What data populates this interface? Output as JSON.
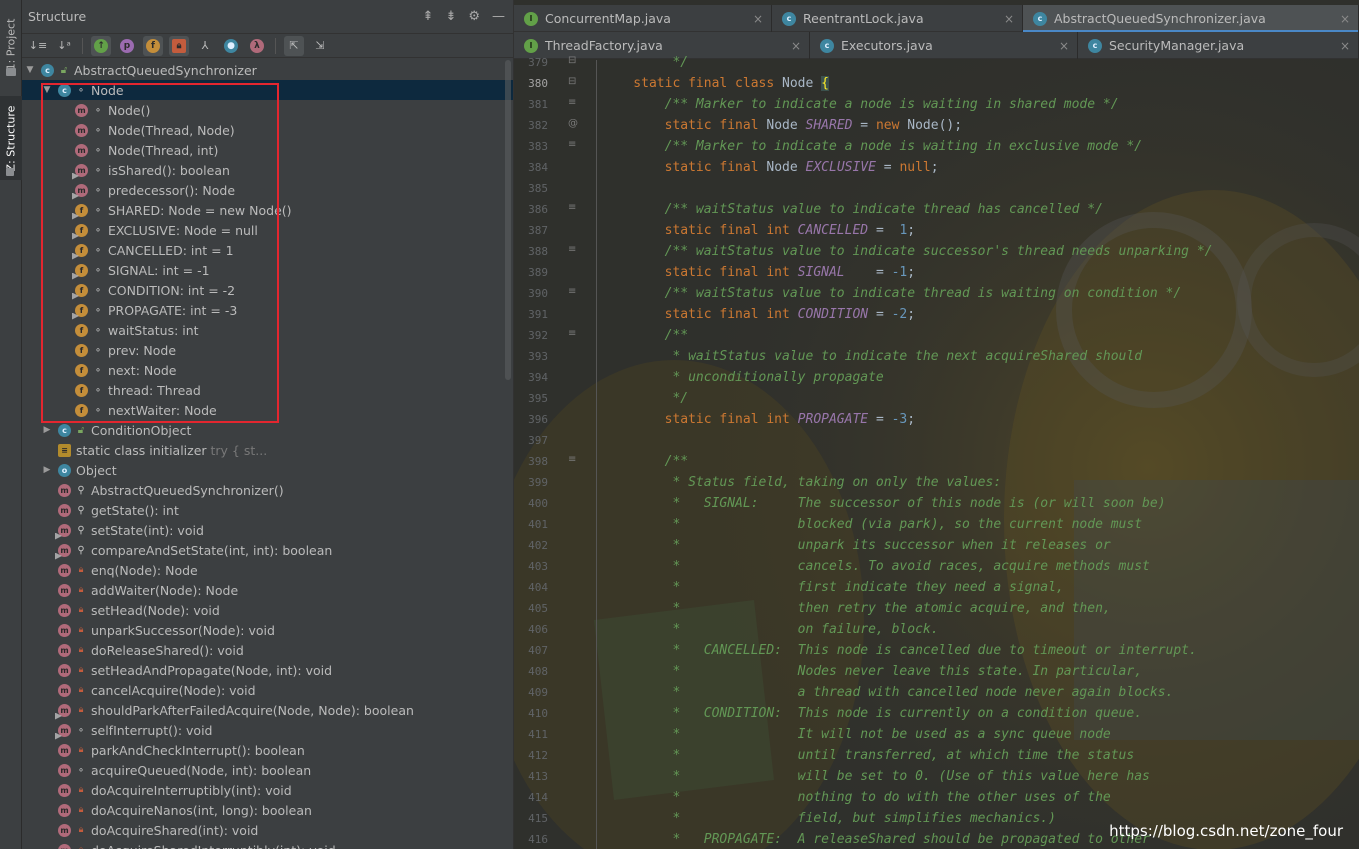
{
  "strip": {
    "project_tab": "1: Project",
    "structure_tab": "Z: Structure"
  },
  "panel": {
    "title": "Structure",
    "header_icons": [
      "expand-all-icon",
      "collapse-all-icon",
      "settings-gear-icon",
      "hide-icon"
    ],
    "toolbar_icons": [
      "sort-by-visibility-icon",
      "sort-alphabetically-icon",
      "show-inherited-icon",
      "show-properties-icon",
      "show-fields-icon",
      "show-non-public-icon",
      "show-lambdas-icon",
      "show-anonymous-icon",
      "show-lambda-icon",
      "autoscroll-to-source-icon",
      "autoscroll-from-source-icon"
    ]
  },
  "tree": [
    {
      "indent": 0,
      "arrow": "▼",
      "icon": "c",
      "vis": "pub",
      "label": "AbstractQueuedSynchronizer",
      "hint": ""
    },
    {
      "indent": 1,
      "arrow": "▼",
      "icon": "c",
      "vis": "prot",
      "label": "Node",
      "hint": "",
      "selected": true
    },
    {
      "indent": 2,
      "arrow": "",
      "icon": "m",
      "vis": "prot",
      "label": "Node()",
      "hint": ""
    },
    {
      "indent": 2,
      "arrow": "",
      "icon": "m",
      "vis": "prot",
      "label": "Node(Thread, Node)",
      "hint": ""
    },
    {
      "indent": 2,
      "arrow": "",
      "icon": "m",
      "vis": "prot",
      "label": "Node(Thread, int)",
      "hint": ""
    },
    {
      "indent": 2,
      "arrow": "",
      "icon": "m",
      "vis": "prot",
      "label": "isShared(): boolean",
      "pin": true,
      "hint": ""
    },
    {
      "indent": 2,
      "arrow": "",
      "icon": "m",
      "vis": "prot",
      "label": "predecessor(): Node",
      "pin": true,
      "hint": ""
    },
    {
      "indent": 2,
      "arrow": "",
      "icon": "f",
      "vis": "prot",
      "label": "SHARED: Node = new Node()",
      "pin": true,
      "hint": ""
    },
    {
      "indent": 2,
      "arrow": "",
      "icon": "f",
      "vis": "prot",
      "label": "EXCLUSIVE: Node = null",
      "pin": true,
      "hint": ""
    },
    {
      "indent": 2,
      "arrow": "",
      "icon": "f",
      "vis": "prot",
      "label": "CANCELLED: int = 1",
      "pin": true,
      "hint": ""
    },
    {
      "indent": 2,
      "arrow": "",
      "icon": "f",
      "vis": "prot",
      "label": "SIGNAL: int = -1",
      "pin": true,
      "hint": ""
    },
    {
      "indent": 2,
      "arrow": "",
      "icon": "f",
      "vis": "prot",
      "label": "CONDITION: int = -2",
      "pin": true,
      "hint": ""
    },
    {
      "indent": 2,
      "arrow": "",
      "icon": "f",
      "vis": "prot",
      "label": "PROPAGATE: int = -3",
      "pin": true,
      "hint": ""
    },
    {
      "indent": 2,
      "arrow": "",
      "icon": "f",
      "vis": "prot",
      "label": "waitStatus: int",
      "hint": ""
    },
    {
      "indent": 2,
      "arrow": "",
      "icon": "f",
      "vis": "prot",
      "label": "prev: Node",
      "hint": ""
    },
    {
      "indent": 2,
      "arrow": "",
      "icon": "f",
      "vis": "prot",
      "label": "next: Node",
      "hint": ""
    },
    {
      "indent": 2,
      "arrow": "",
      "icon": "f",
      "vis": "prot",
      "label": "thread: Thread",
      "hint": ""
    },
    {
      "indent": 2,
      "arrow": "",
      "icon": "f",
      "vis": "prot",
      "label": "nextWaiter: Node",
      "hint": ""
    },
    {
      "indent": 1,
      "arrow": "▶",
      "icon": "c",
      "vis": "pub",
      "label": "ConditionObject",
      "hint": ""
    },
    {
      "indent": 1,
      "arrow": "",
      "icon": "s",
      "vis": "",
      "label": "static class initializer",
      "hint": "  try {              st..."
    },
    {
      "indent": 1,
      "arrow": "▶",
      "icon": "o",
      "vis": "",
      "label": "Object",
      "hint": ""
    },
    {
      "indent": 1,
      "arrow": "",
      "icon": "m",
      "vis": "key",
      "label": "AbstractQueuedSynchronizer()",
      "hint": ""
    },
    {
      "indent": 1,
      "arrow": "",
      "icon": "m",
      "vis": "key",
      "label": "getState(): int",
      "hint": ""
    },
    {
      "indent": 1,
      "arrow": "",
      "icon": "m",
      "vis": "key",
      "label": "setState(int): void",
      "pin": true,
      "hint": ""
    },
    {
      "indent": 1,
      "arrow": "",
      "icon": "m",
      "vis": "key",
      "label": "compareAndSetState(int, int): boolean",
      "pin": true,
      "hint": ""
    },
    {
      "indent": 1,
      "arrow": "",
      "icon": "m",
      "vis": "lock",
      "label": "enq(Node): Node",
      "hint": ""
    },
    {
      "indent": 1,
      "arrow": "",
      "icon": "m",
      "vis": "lock",
      "label": "addWaiter(Node): Node",
      "hint": ""
    },
    {
      "indent": 1,
      "arrow": "",
      "icon": "m",
      "vis": "lock",
      "label": "setHead(Node): void",
      "hint": ""
    },
    {
      "indent": 1,
      "arrow": "",
      "icon": "m",
      "vis": "lock",
      "label": "unparkSuccessor(Node): void",
      "hint": ""
    },
    {
      "indent": 1,
      "arrow": "",
      "icon": "m",
      "vis": "lock",
      "label": "doReleaseShared(): void",
      "hint": ""
    },
    {
      "indent": 1,
      "arrow": "",
      "icon": "m",
      "vis": "lock",
      "label": "setHeadAndPropagate(Node, int): void",
      "hint": ""
    },
    {
      "indent": 1,
      "arrow": "",
      "icon": "m",
      "vis": "lock",
      "label": "cancelAcquire(Node): void",
      "hint": ""
    },
    {
      "indent": 1,
      "arrow": "",
      "icon": "m",
      "vis": "lock",
      "label": "shouldParkAfterFailedAcquire(Node, Node): boolean",
      "pin": true,
      "hint": ""
    },
    {
      "indent": 1,
      "arrow": "",
      "icon": "m",
      "vis": "prot",
      "label": "selfInterrupt(): void",
      "pin": true,
      "hint": ""
    },
    {
      "indent": 1,
      "arrow": "",
      "icon": "m",
      "vis": "lock",
      "label": "parkAndCheckInterrupt(): boolean",
      "hint": ""
    },
    {
      "indent": 1,
      "arrow": "",
      "icon": "m",
      "vis": "prot",
      "label": "acquireQueued(Node, int): boolean",
      "hint": ""
    },
    {
      "indent": 1,
      "arrow": "",
      "icon": "m",
      "vis": "lock",
      "label": "doAcquireInterruptibly(int): void",
      "hint": ""
    },
    {
      "indent": 1,
      "arrow": "",
      "icon": "m",
      "vis": "lock",
      "label": "doAcquireNanos(int, long): boolean",
      "hint": ""
    },
    {
      "indent": 1,
      "arrow": "",
      "icon": "m",
      "vis": "lock",
      "label": "doAcquireShared(int): void",
      "hint": ""
    },
    {
      "indent": 1,
      "arrow": "",
      "icon": "m",
      "vis": "lock",
      "label": "doAcquireSharedInterruptibly(int): void",
      "hint": ""
    }
  ],
  "tabs_row1": [
    {
      "label": "ConcurrentMap.java",
      "kind": "int",
      "active": false
    },
    {
      "label": "ReentrantLock.java",
      "kind": "cls",
      "active": false
    },
    {
      "label": "AbstractQueuedSynchronizer.java",
      "kind": "cls",
      "active": true
    }
  ],
  "tabs_row2": [
    {
      "label": "ThreadFactory.java",
      "kind": "int",
      "active": false
    },
    {
      "label": "Executors.java",
      "kind": "cls",
      "active": false
    },
    {
      "label": "SecurityManager.java",
      "kind": "cls",
      "active": false
    }
  ],
  "editor": {
    "lines": [
      {
        "n": "379",
        "mark": "fold",
        "segs": [
          [
            "cm",
            "         */"
          ]
        ]
      },
      {
        "n": "380",
        "mark": "fold",
        "cur": true,
        "segs": [
          [
            "kw",
            "    static final class "
          ],
          [
            "ty",
            "Node "
          ],
          [
            "br",
            "{"
          ]
        ]
      },
      {
        "n": "381",
        "mark": "doc",
        "segs": [
          [
            "cm",
            "        /** Marker to indicate a node is waiting in shared mode */"
          ]
        ]
      },
      {
        "n": "382",
        "mark": "at",
        "segs": [
          [
            "kw",
            "        static final "
          ],
          [
            "ty",
            "Node "
          ],
          [
            "sf",
            "SHARED"
          ],
          [
            "ty",
            " = "
          ],
          [
            "kw",
            "new "
          ],
          [
            "ty",
            "Node();"
          ]
        ]
      },
      {
        "n": "383",
        "mark": "doc",
        "segs": [
          [
            "cm",
            "        /** Marker to indicate a node is waiting in exclusive mode */"
          ]
        ]
      },
      {
        "n": "384",
        "mark": "",
        "segs": [
          [
            "kw",
            "        static final "
          ],
          [
            "ty",
            "Node "
          ],
          [
            "sf",
            "EXCLUSIVE"
          ],
          [
            "ty",
            " = "
          ],
          [
            "kw",
            "null"
          ],
          [
            "ty",
            ";"
          ]
        ]
      },
      {
        "n": "385",
        "mark": "",
        "segs": [
          [
            "ty",
            ""
          ]
        ]
      },
      {
        "n": "386",
        "mark": "doc",
        "segs": [
          [
            "cm",
            "        /** waitStatus value to indicate thread has cancelled */"
          ]
        ]
      },
      {
        "n": "387",
        "mark": "",
        "segs": [
          [
            "kw",
            "        static final int "
          ],
          [
            "sf",
            "CANCELLED"
          ],
          [
            "ty",
            " =  "
          ],
          [
            "num",
            "1"
          ],
          [
            "ty",
            ";"
          ]
        ]
      },
      {
        "n": "388",
        "mark": "doc",
        "segs": [
          [
            "cm",
            "        /** waitStatus value to indicate successor's thread needs unparking */"
          ]
        ]
      },
      {
        "n": "389",
        "mark": "",
        "segs": [
          [
            "kw",
            "        static final int "
          ],
          [
            "sf",
            "SIGNAL"
          ],
          [
            "ty",
            "    = "
          ],
          [
            "num",
            "-1"
          ],
          [
            "ty",
            ";"
          ]
        ]
      },
      {
        "n": "390",
        "mark": "doc",
        "segs": [
          [
            "cm",
            "        /** waitStatus value to indicate thread is waiting on condition */"
          ]
        ]
      },
      {
        "n": "391",
        "mark": "",
        "segs": [
          [
            "kw",
            "        static final int "
          ],
          [
            "sf",
            "CONDITION"
          ],
          [
            "ty",
            " = "
          ],
          [
            "num",
            "-2"
          ],
          [
            "ty",
            ";"
          ]
        ]
      },
      {
        "n": "392",
        "mark": "doc",
        "segs": [
          [
            "cm",
            "        /**"
          ]
        ]
      },
      {
        "n": "393",
        "mark": "",
        "segs": [
          [
            "cm",
            "         * waitStatus value to indicate the next acquireShared should"
          ]
        ]
      },
      {
        "n": "394",
        "mark": "",
        "segs": [
          [
            "cm",
            "         * unconditionally propagate"
          ]
        ]
      },
      {
        "n": "395",
        "mark": "",
        "segs": [
          [
            "cm",
            "         */"
          ]
        ]
      },
      {
        "n": "396",
        "mark": "",
        "segs": [
          [
            "kw",
            "        static final int "
          ],
          [
            "sf",
            "PROPAGATE"
          ],
          [
            "ty",
            " = "
          ],
          [
            "num",
            "-3"
          ],
          [
            "ty",
            ";"
          ]
        ]
      },
      {
        "n": "397",
        "mark": "",
        "segs": [
          [
            "ty",
            ""
          ]
        ]
      },
      {
        "n": "398",
        "mark": "doc",
        "segs": [
          [
            "cm",
            "        /**"
          ]
        ]
      },
      {
        "n": "399",
        "mark": "",
        "segs": [
          [
            "cm",
            "         * Status field, taking on only the values:"
          ]
        ]
      },
      {
        "n": "400",
        "mark": "",
        "segs": [
          [
            "cm",
            "         *   SIGNAL:     The successor of this node is (or will soon be)"
          ]
        ]
      },
      {
        "n": "401",
        "mark": "",
        "segs": [
          [
            "cm",
            "         *               blocked (via park), so the current node must"
          ]
        ]
      },
      {
        "n": "402",
        "mark": "",
        "segs": [
          [
            "cm",
            "         *               unpark its successor when it releases or"
          ]
        ]
      },
      {
        "n": "403",
        "mark": "",
        "segs": [
          [
            "cm",
            "         *               cancels. To avoid races, acquire methods must"
          ]
        ]
      },
      {
        "n": "404",
        "mark": "",
        "segs": [
          [
            "cm",
            "         *               first indicate they need a signal,"
          ]
        ]
      },
      {
        "n": "405",
        "mark": "",
        "segs": [
          [
            "cm",
            "         *               then retry the atomic acquire, and then,"
          ]
        ]
      },
      {
        "n": "406",
        "mark": "",
        "segs": [
          [
            "cm",
            "         *               on failure, block."
          ]
        ]
      },
      {
        "n": "407",
        "mark": "",
        "segs": [
          [
            "cm",
            "         *   CANCELLED:  This node is cancelled due to timeout or interrupt."
          ]
        ]
      },
      {
        "n": "408",
        "mark": "",
        "segs": [
          [
            "cm",
            "         *               Nodes never leave this state. In particular,"
          ]
        ]
      },
      {
        "n": "409",
        "mark": "",
        "segs": [
          [
            "cm",
            "         *               a thread with cancelled node never again blocks."
          ]
        ]
      },
      {
        "n": "410",
        "mark": "",
        "segs": [
          [
            "cm",
            "         *   CONDITION:  This node is currently on a condition queue."
          ]
        ]
      },
      {
        "n": "411",
        "mark": "",
        "segs": [
          [
            "cm",
            "         *               It will not be used as a sync queue node"
          ]
        ]
      },
      {
        "n": "412",
        "mark": "",
        "segs": [
          [
            "cm",
            "         *               until transferred, at which time the status"
          ]
        ]
      },
      {
        "n": "413",
        "mark": "",
        "segs": [
          [
            "cm",
            "         *               will be set to 0. (Use of this value here has"
          ]
        ]
      },
      {
        "n": "414",
        "mark": "",
        "segs": [
          [
            "cm",
            "         *               nothing to do with the other uses of the"
          ]
        ]
      },
      {
        "n": "415",
        "mark": "",
        "segs": [
          [
            "cm",
            "         *               field, but simplifies mechanics.)"
          ]
        ]
      },
      {
        "n": "416",
        "mark": "",
        "segs": [
          [
            "cm",
            "         *   PROPAGATE:  A releaseShared should be propagated to other"
          ]
        ]
      }
    ]
  },
  "watermark": "https://blog.csdn.net/zone_four"
}
